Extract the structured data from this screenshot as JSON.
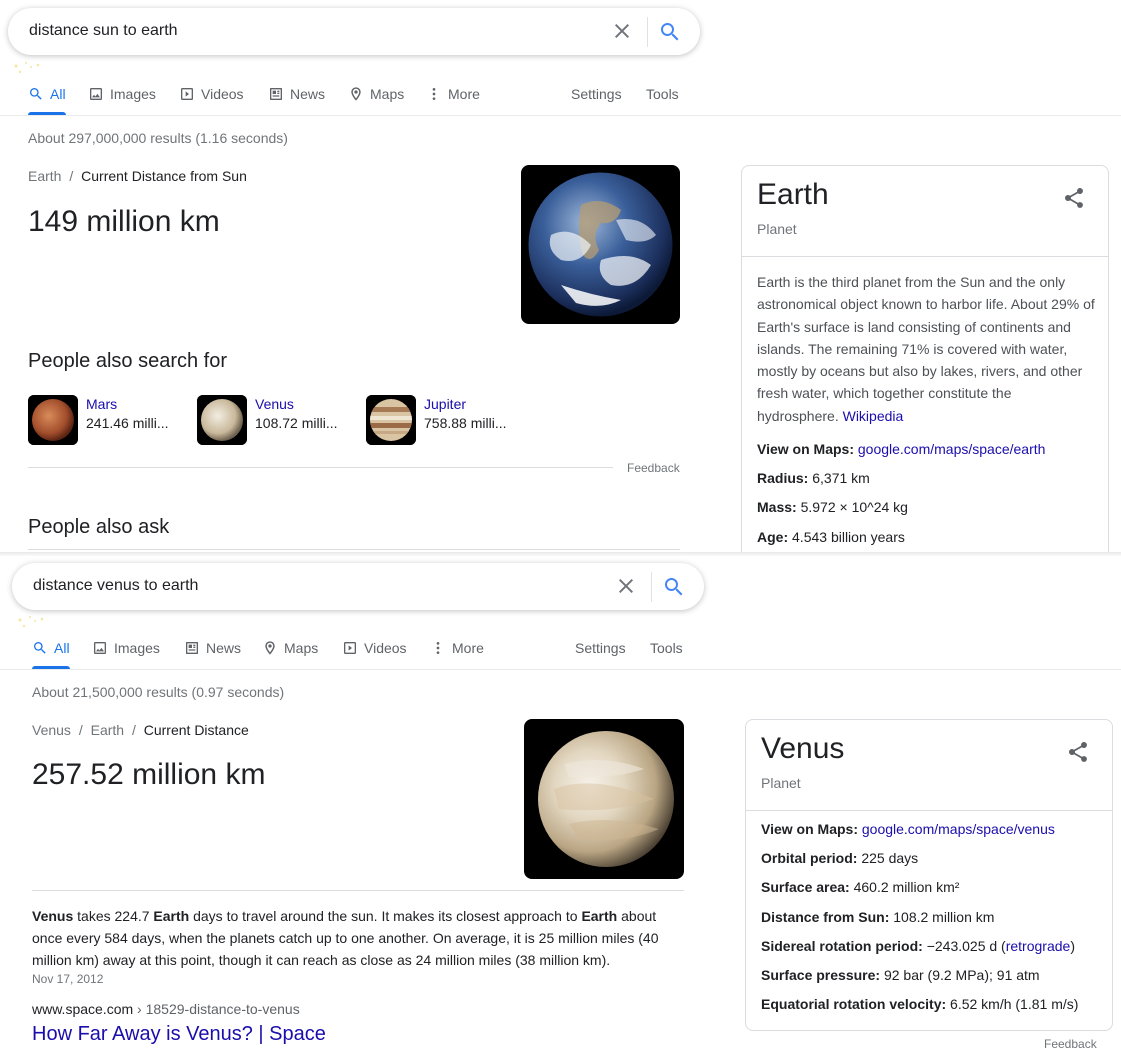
{
  "panel1": {
    "query": "distance sun to earth",
    "tabs": [
      "All",
      "Images",
      "Videos",
      "News",
      "Maps",
      "More"
    ],
    "settings": "Settings",
    "tools": "Tools",
    "stats": "About 297,000,000 results (1.16 seconds)",
    "breadcrumb_parent": "Earth",
    "breadcrumb_sep": "/",
    "breadcrumb_current": "Current Distance from Sun",
    "answer": "149 million km",
    "people_also_search_title": "People also search for",
    "also_search": [
      {
        "name": "Mars",
        "value": "241.46 milli..."
      },
      {
        "name": "Venus",
        "value": "108.72 milli..."
      },
      {
        "name": "Jupiter",
        "value": "758.88 milli..."
      }
    ],
    "feedback": "Feedback",
    "people_also_ask": "People also ask",
    "kp": {
      "title": "Earth",
      "subtitle": "Planet",
      "description": "Earth is the third planet from the Sun and the only astronomical object known to harbor life. About 29% of Earth's surface is land consisting of continents and islands. The remaining 71% is covered with water, mostly by oceans but also by lakes, rivers, and other fresh water, which together constitute the hydrosphere.",
      "source": "Wikipedia",
      "facts": [
        {
          "label": "View on Maps:",
          "value": "google.com/maps/space/earth"
        },
        {
          "label": "Radius:",
          "value": "6,371 km"
        },
        {
          "label": "Mass:",
          "value": "5.972 × 10^24 kg"
        },
        {
          "label": "Age:",
          "value": "4.543 billion years"
        }
      ]
    }
  },
  "panel2": {
    "query": "distance venus to earth",
    "tabs": [
      "All",
      "Images",
      "News",
      "Maps",
      "Videos",
      "More"
    ],
    "settings": "Settings",
    "tools": "Tools",
    "stats": "About 21,500,000 results (0.97 seconds)",
    "breadcrumb_a": "Venus",
    "breadcrumb_b": "Earth",
    "breadcrumb_sep": "/",
    "breadcrumb_current": "Current Distance",
    "answer": "257.52 million km",
    "snippet": {
      "w1": "Venus",
      "t1": " takes 224.7 ",
      "w2": "Earth",
      "t2": " days to travel around the sun. It makes its closest approach to ",
      "w3": "Earth",
      "t3": " about once every 584 days, when the planets catch up to one another. On average, it is 25 million miles (40 million km) away at this point, though it can reach as close as 24 million miles (38 million km)."
    },
    "snippet_date": "Nov 17, 2012",
    "cite_domain": "www.space.com",
    "cite_path": " › 18529-distance-to-venus",
    "result_title": "How Far Away is Venus? | Space",
    "feedback": "Feedback",
    "kp": {
      "title": "Venus",
      "subtitle": "Planet",
      "facts": [
        {
          "label": "View on Maps:",
          "value": "google.com/maps/space/venus"
        },
        {
          "label": "Orbital period:",
          "value": "225 days"
        },
        {
          "label": "Surface area:",
          "value": "460.2 million km²"
        },
        {
          "label": "Distance from Sun:",
          "value": "108.2 million km"
        },
        {
          "label": "Sidereal rotation period:",
          "value": "−243.025 d (",
          "link": "retrograde",
          "after": ")"
        },
        {
          "label": "Surface pressure:",
          "value": "92 bar (9.2 MPa); 91 atm"
        },
        {
          "label": "Equatorial rotation velocity:",
          "value": "6.52 km/h (1.81 m/s)"
        }
      ]
    }
  },
  "colors": {
    "accent": "#1a73e8",
    "link": "#1a0dab",
    "muted": "#70757a"
  }
}
